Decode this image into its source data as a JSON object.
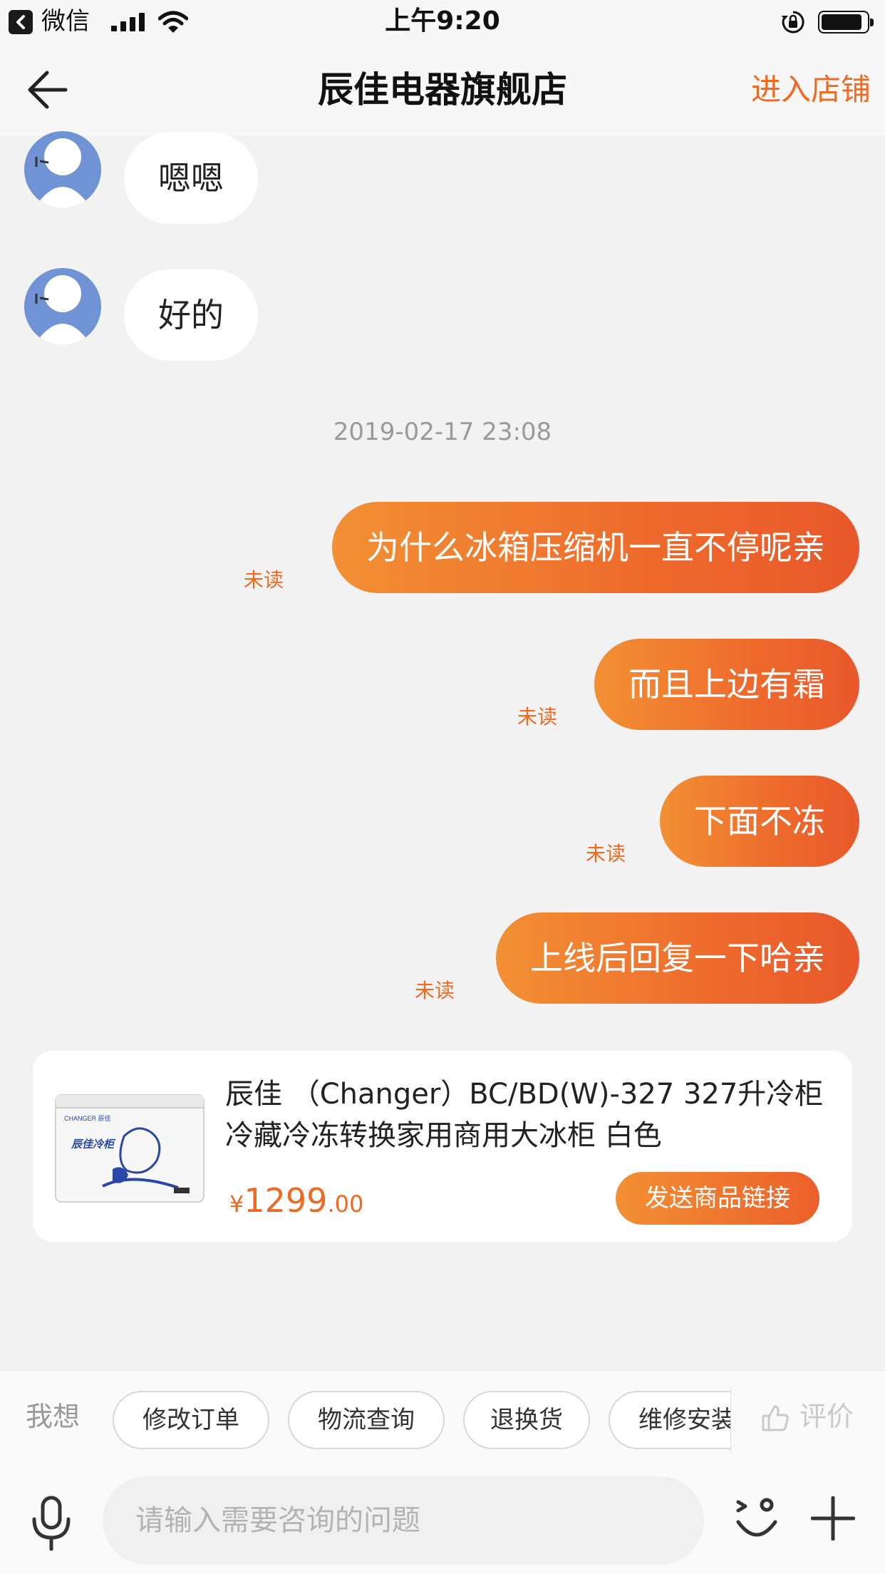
{
  "status_bar": {
    "app_name": "微信",
    "time": "上午9:20"
  },
  "nav": {
    "title": "辰佳电器旗舰店",
    "store_link": "进入店铺"
  },
  "messages": {
    "incoming": [
      {
        "text": "嗯嗯"
      },
      {
        "text": "好的"
      }
    ],
    "timestamp": "2019-02-17 23:08",
    "outgoing": [
      {
        "text": "为什么冰箱压缩机一直不停呢亲",
        "status": "未读"
      },
      {
        "text": "而且上边有霜",
        "status": "未读"
      },
      {
        "text": "下面不冻",
        "status": "未读"
      },
      {
        "text": "上线后回复一下哈亲",
        "status": "未读"
      }
    ]
  },
  "product_card": {
    "title": "辰佳 （Changer）BC/BD(W)-327 327升冷柜冷藏冷冻转换家用商用大冰柜 白色",
    "currency": "¥",
    "price_integer": "1299",
    "price_decimal": ".00",
    "send_button": "发送商品链接",
    "image_brand": "CHANGER 辰佳",
    "image_slogan": "辰佳冷柜"
  },
  "quick_replies": {
    "label": "我想",
    "chips": [
      "修改订单",
      "物流查询",
      "退换货",
      "维修安装"
    ],
    "rate_label": "评价"
  },
  "input": {
    "placeholder": "请输入需要咨询的问题"
  },
  "colors": {
    "accent": "#ee6a22",
    "bubble_gradient_start": "#f29034",
    "bubble_gradient_end": "#e8582b",
    "avatar": "#6f93d4",
    "background": "#f2f2f2"
  },
  "icons": [
    "back-arrow-icon",
    "signal-icon",
    "wifi-icon",
    "lock-rotation-icon",
    "battery-icon",
    "avatar-icon",
    "thumbs-up-icon",
    "microphone-icon",
    "emoji-icon",
    "plus-icon"
  ]
}
